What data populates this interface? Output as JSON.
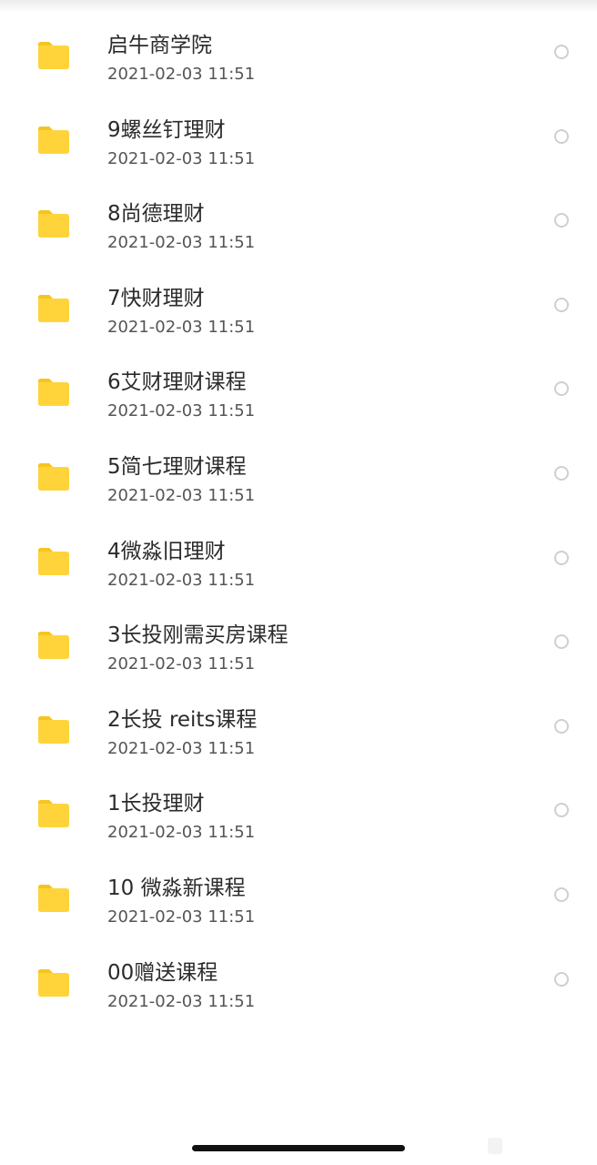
{
  "file_list": {
    "items": [
      {
        "name": "启牛商学院",
        "modified": "2021-02-03 11:51",
        "icon": "folder-icon"
      },
      {
        "name": "9螺丝钉理财",
        "modified": "2021-02-03 11:51",
        "icon": "folder-icon"
      },
      {
        "name": "8尚德理财",
        "modified": "2021-02-03 11:51",
        "icon": "folder-icon"
      },
      {
        "name": "7快财理财",
        "modified": "2021-02-03 11:51",
        "icon": "folder-icon"
      },
      {
        "name": "6艾财理财课程",
        "modified": "2021-02-03 11:51",
        "icon": "folder-icon"
      },
      {
        "name": "5简七理财课程",
        "modified": "2021-02-03 11:51",
        "icon": "folder-icon"
      },
      {
        "name": "4微淼旧理财",
        "modified": "2021-02-03 11:51",
        "icon": "folder-icon"
      },
      {
        "name": "3长投刚需买房课程",
        "modified": "2021-02-03 11:51",
        "icon": "folder-icon"
      },
      {
        "name": "2长投 reits课程",
        "modified": "2021-02-03 11:51",
        "icon": "folder-icon"
      },
      {
        "name": "1长投理财",
        "modified": "2021-02-03 11:51",
        "icon": "folder-icon"
      },
      {
        "name": "10 微淼新课程",
        "modified": "2021-02-03 11:51",
        "icon": "folder-icon"
      },
      {
        "name": "00赠送课程",
        "modified": "2021-02-03 11:51",
        "icon": "folder-icon"
      }
    ]
  },
  "colors": {
    "folder": "#FFD43B",
    "folder_tab": "#F7C41F",
    "text_primary": "#2B2B2B",
    "text_secondary": "#555555",
    "radio_border": "#CFCFCF",
    "home_indicator": "#111111"
  }
}
